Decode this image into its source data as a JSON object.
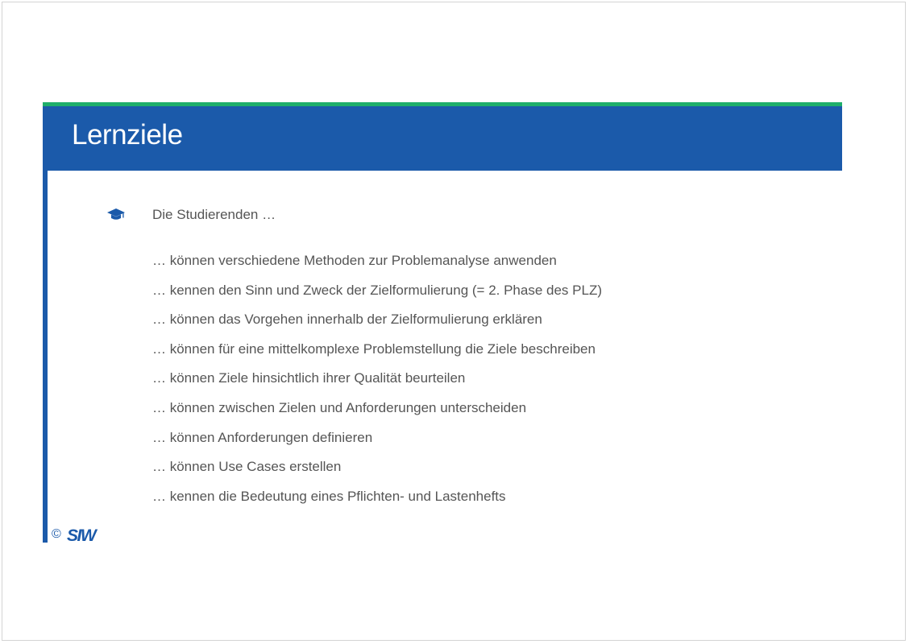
{
  "slide": {
    "title": "Lernziele",
    "intro": "Die Studierenden …",
    "learning_goals": [
      "… können verschiedene Methoden zur Problemanalyse anwenden",
      "… kennen den Sinn und Zweck der Zielformulierung (= 2. Phase des PLZ)",
      "… können das Vorgehen innerhalb der Zielformulierung erklären",
      "… können für eine mittelkomplexe Problemstellung die Ziele beschreiben",
      "… können Ziele hinsichtlich ihrer Qualität beurteilen",
      "… können zwischen Zielen und Anforderungen unterscheiden",
      "… können Anforderungen definieren",
      "… können Use Cases erstellen",
      "… kennen die Bedeutung eines Pflichten- und Lastenhefts"
    ],
    "intro_icon": "graduation-cap-icon"
  },
  "footer": {
    "copyright_symbol": "©",
    "logo_text": "SIW"
  },
  "colors": {
    "title_bar": "#1b5aaa",
    "accent_line": "#1fae6a",
    "body_text": "#555555",
    "logo": "#1b5aaa"
  }
}
